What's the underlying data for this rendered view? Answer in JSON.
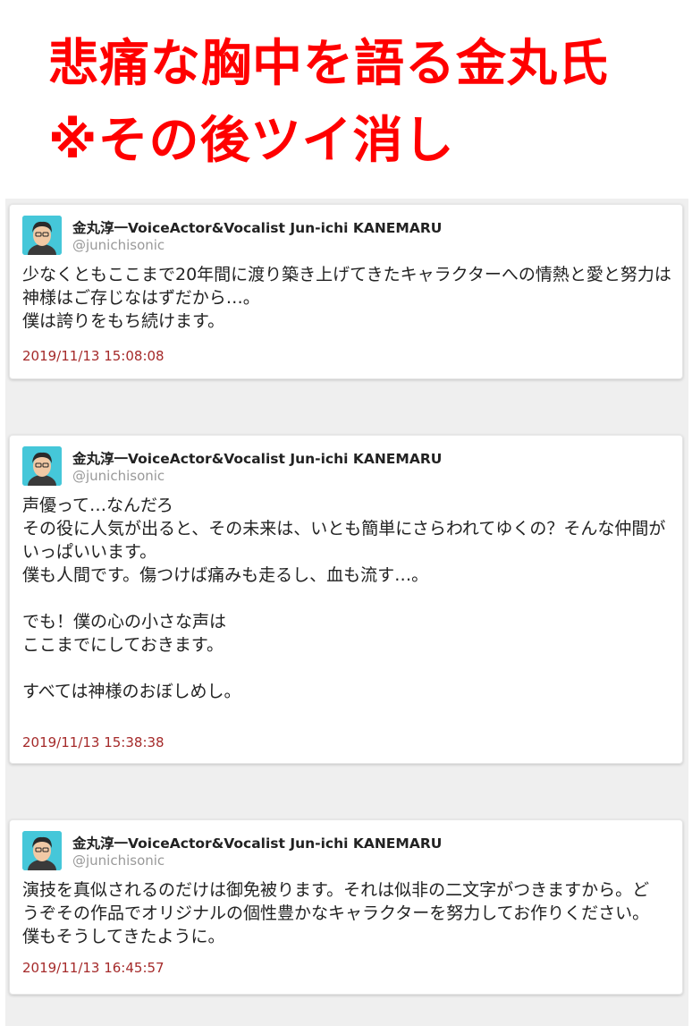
{
  "headline": {
    "line1": "悲痛な胸中を語る金丸氏",
    "line2": "※その後ツイ消し"
  },
  "author": {
    "name": "金丸淳一VoiceActor&Vocalist Jun-ichi KANEMARU",
    "handle": "@junichisonic",
    "avatar_icon": "user-avatar-icon"
  },
  "colors": {
    "headline": "#ff0000",
    "timestamp": "#a52a2a",
    "background": "#efefef"
  },
  "tweets": [
    {
      "lines": [
        "少なくともここまで20年間に渡り築き上げてきたキャラクターへの情熱と愛と努力は",
        "神様はご存じなはずだから…。",
        "僕は誇りをもち続けます。"
      ],
      "time": "2019/11/13 15:08:08"
    },
    {
      "lines": [
        "声優って…なんだろ",
        "その役に人気が出ると、その未来は、いとも簡単にさらわれてゆくの？そんな仲間が",
        "いっぱいいます。",
        "僕も人間です。傷つけば痛みも走るし、血も流す…。",
        "",
        "でも！僕の心の小さな声は",
        "ここまでにしておきます。",
        "",
        "すべては神様のおぼしめし。"
      ],
      "time": "2019/11/13 15:38:38"
    },
    {
      "lines": [
        "演技を真似されるのだけは御免被ります。それは似非の二文字がつきますから。ど",
        "うぞその作品でオリジナルの個性豊かなキャラクターを努力してお作りください。",
        "僕もそうしてきたように。"
      ],
      "time": "2019/11/13 16:45:57"
    }
  ]
}
